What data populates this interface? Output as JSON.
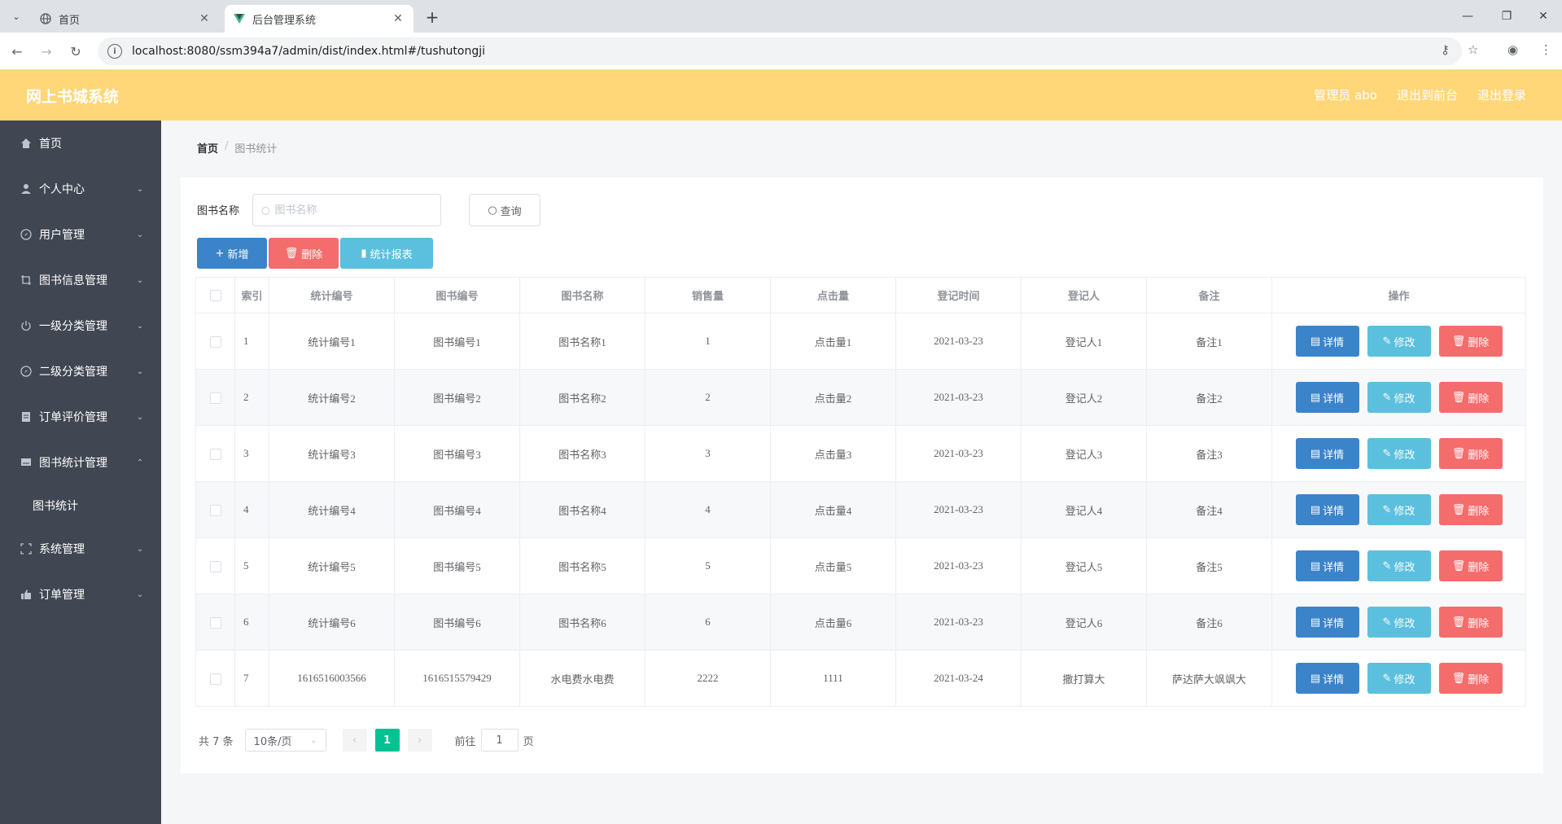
{
  "browser": {
    "tabs": [
      {
        "title": "首页",
        "active": false
      },
      {
        "title": "后台管理系统",
        "active": true
      }
    ],
    "url": "localhost:8080/ssm394a7/admin/dist/index.html#/tushutongji"
  },
  "header": {
    "title": "网上书城系统",
    "user": "管理员 abo",
    "front_link": "退出到前台",
    "logout": "退出登录"
  },
  "sidebar": {
    "items": [
      {
        "label": "首页",
        "icon": "home-icon"
      },
      {
        "label": "个人中心",
        "icon": "user-icon"
      },
      {
        "label": "用户管理",
        "icon": "compass-icon"
      },
      {
        "label": "图书信息管理",
        "icon": "crop-icon"
      },
      {
        "label": "一级分类管理",
        "icon": "power-icon"
      },
      {
        "label": "二级分类管理",
        "icon": "compass-icon"
      },
      {
        "label": "订单评价管理",
        "icon": "document-icon"
      },
      {
        "label": "图书统计管理",
        "icon": "message-icon"
      },
      {
        "label": "系统管理",
        "icon": "fullscreen-icon"
      },
      {
        "label": "订单管理",
        "icon": "thumb-icon"
      }
    ],
    "sub_item": "图书统计"
  },
  "breadcrumb": {
    "home": "首页",
    "current": "图书统计"
  },
  "search": {
    "label": "图书名称",
    "placeholder": "图书名称",
    "button": "查询"
  },
  "actions": {
    "add": "新增",
    "delete": "删除",
    "report": "统计报表"
  },
  "table": {
    "headers": [
      "索引",
      "统计编号",
      "图书编号",
      "图书名称",
      "销售量",
      "点击量",
      "登记时间",
      "登记人",
      "备注",
      "操作"
    ],
    "rows": [
      [
        "1",
        "统计编号1",
        "图书编号1",
        "图书名称1",
        "1",
        "点击量1",
        "2021-03-23",
        "登记人1",
        "备注1"
      ],
      [
        "2",
        "统计编号2",
        "图书编号2",
        "图书名称2",
        "2",
        "点击量2",
        "2021-03-23",
        "登记人2",
        "备注2"
      ],
      [
        "3",
        "统计编号3",
        "图书编号3",
        "图书名称3",
        "3",
        "点击量3",
        "2021-03-23",
        "登记人3",
        "备注3"
      ],
      [
        "4",
        "统计编号4",
        "图书编号4",
        "图书名称4",
        "4",
        "点击量4",
        "2021-03-23",
        "登记人4",
        "备注4"
      ],
      [
        "5",
        "统计编号5",
        "图书编号5",
        "图书名称5",
        "5",
        "点击量5",
        "2021-03-23",
        "登记人5",
        "备注5"
      ],
      [
        "6",
        "统计编号6",
        "图书编号6",
        "图书名称6",
        "6",
        "点击量6",
        "2021-03-23",
        "登记人6",
        "备注6"
      ],
      [
        "7",
        "1616516003566",
        "1616515579429",
        "水电费水电费",
        "2222",
        "1111",
        "2021-03-24",
        "撒打算大",
        "萨达萨大飒飒大"
      ]
    ],
    "row_actions": {
      "detail": "详情",
      "edit": "修改",
      "delete": "删除"
    }
  },
  "pager": {
    "total": "共 7 条",
    "page_size": "10条/页",
    "current": "1",
    "goto_label": "前往",
    "goto_value": "1",
    "page_suffix": "页"
  },
  "colors": {
    "header": "#ffd779",
    "sidebar": "#404652",
    "primary": "#3c84c9",
    "danger": "#f56c6c",
    "info": "#5bc0de",
    "pager_active": "#00c292"
  }
}
